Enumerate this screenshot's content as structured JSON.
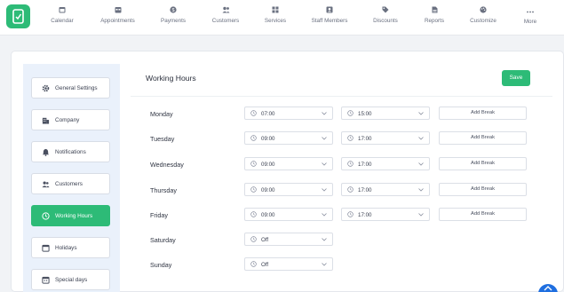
{
  "nav": {
    "items": [
      {
        "label": "Calendar",
        "icon": "calendar-icon"
      },
      {
        "label": "Appointments",
        "icon": "appointments-icon"
      },
      {
        "label": "Payments",
        "icon": "payments-icon"
      },
      {
        "label": "Customers",
        "icon": "customers-icon"
      },
      {
        "label": "Services",
        "icon": "services-icon"
      },
      {
        "label": "Staff Members",
        "icon": "staff-icon"
      },
      {
        "label": "Discounts",
        "icon": "discount-tag-icon"
      },
      {
        "label": "Reports",
        "icon": "reports-icon"
      },
      {
        "label": "Customize",
        "icon": "palette-icon"
      },
      {
        "label": "More",
        "icon": "more-dots-icon"
      }
    ]
  },
  "sidebar": {
    "items": [
      {
        "label": "General Settings",
        "icon": "gear-icon"
      },
      {
        "label": "Company",
        "icon": "building-icon"
      },
      {
        "label": "Notifications",
        "icon": "bell-icon"
      },
      {
        "label": "Customers",
        "icon": "customers-icon"
      },
      {
        "label": "Working Hours",
        "icon": "clock-icon",
        "active": true
      },
      {
        "label": "Holidays",
        "icon": "calendar-icon"
      },
      {
        "label": "Special days",
        "icon": "calendar-icon"
      }
    ]
  },
  "main": {
    "title": "Working Hours",
    "save_label": "Save",
    "add_break_label": "Add Break",
    "days": [
      {
        "name": "Monday",
        "start": "07:00",
        "end": "15:00"
      },
      {
        "name": "Tuesday",
        "start": "09:00",
        "end": "17:00"
      },
      {
        "name": "Wednesday",
        "start": "09:00",
        "end": "17:00"
      },
      {
        "name": "Thursday",
        "start": "09:00",
        "end": "17:00"
      },
      {
        "name": "Friday",
        "start": "09:00",
        "end": "17:00"
      },
      {
        "name": "Saturday",
        "start": "Off"
      },
      {
        "name": "Sunday",
        "start": "Off"
      }
    ]
  },
  "colors": {
    "accent": "#2dbb77",
    "sidebar_bg": "#eaf1fb",
    "fab": "#1f6fe0"
  }
}
